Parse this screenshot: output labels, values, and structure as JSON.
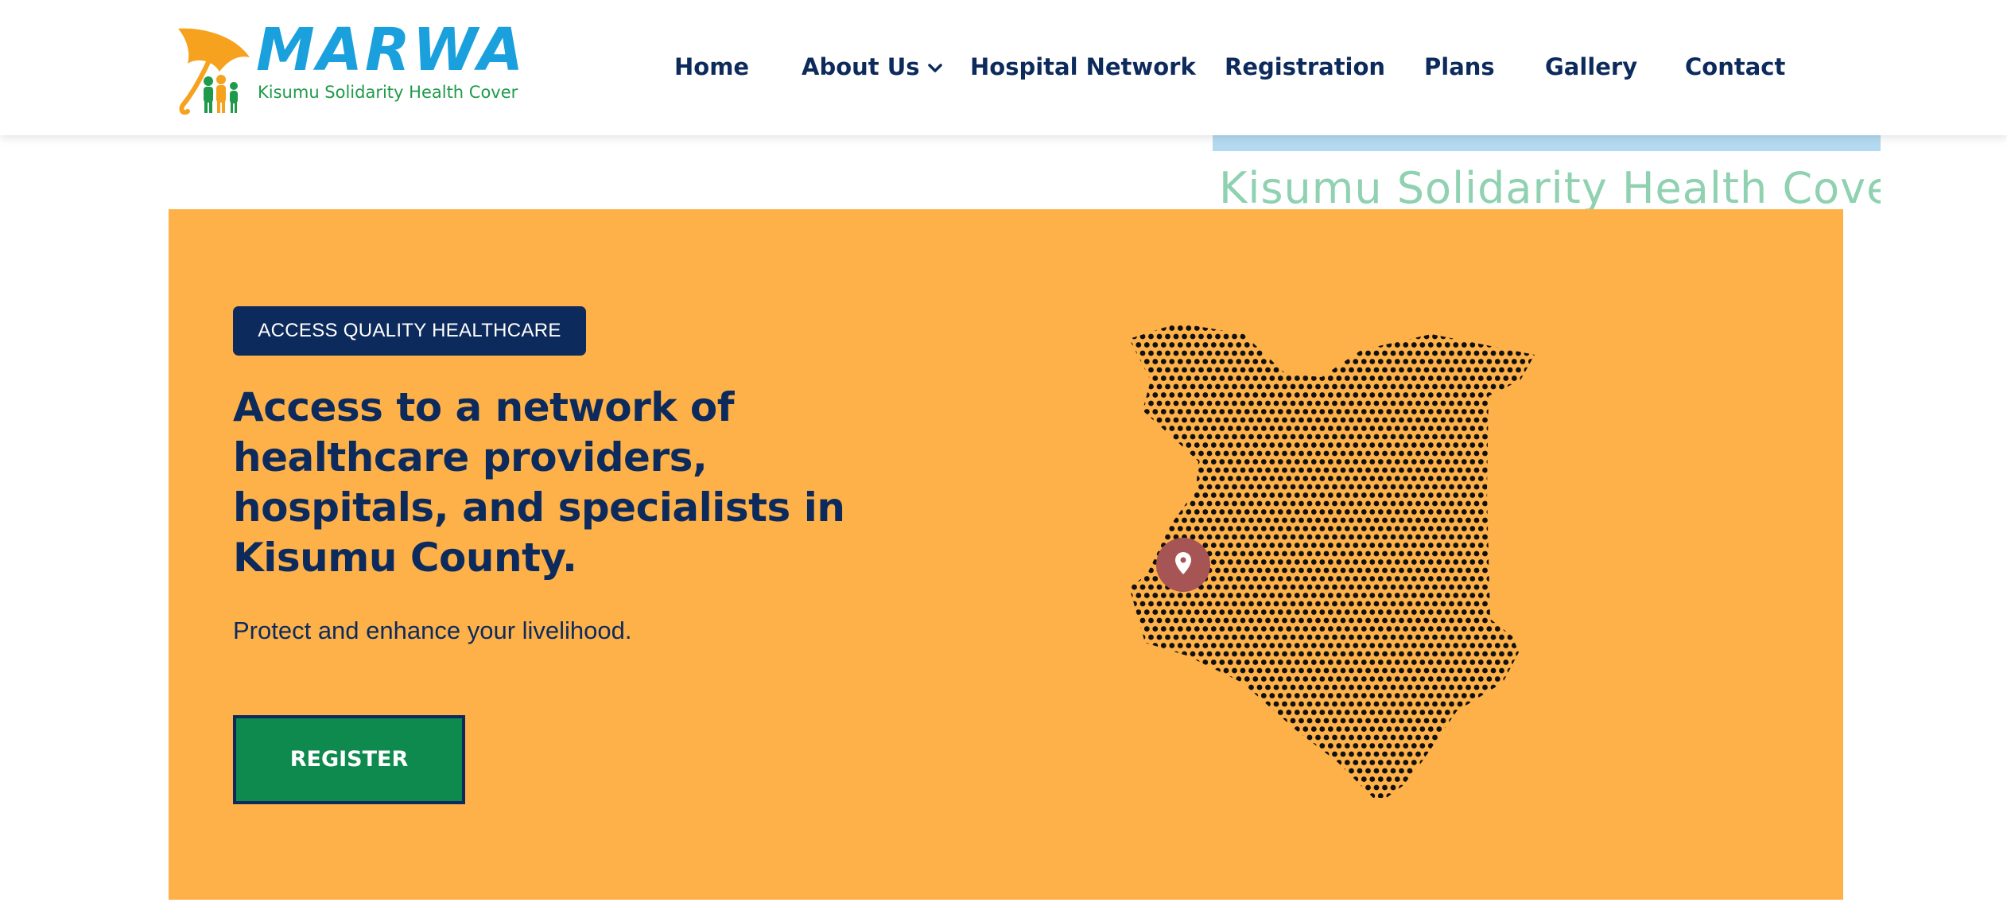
{
  "colors": {
    "navy": "#0d2a5c",
    "hero_bg": "#fdb148",
    "register_green": "#0f8a4f",
    "pin": "#a75454",
    "logo_blue": "#1aa1dd",
    "logo_green": "#1f9a4a",
    "logo_orange": "#f6a21e"
  },
  "logo": {
    "title": "MARWA",
    "tagline": "Kisumu Solidarity Health  Cover",
    "icons": [
      "umbrella-icon",
      "family-icon"
    ]
  },
  "nav": {
    "items": [
      {
        "label": "Home"
      },
      {
        "label": "About Us",
        "icon": "chevron-down-icon"
      },
      {
        "label": "Hospital Network"
      },
      {
        "label": "Registration"
      },
      {
        "label": "Plans"
      },
      {
        "label": "Gallery"
      },
      {
        "label": "Contact"
      }
    ]
  },
  "watermark": {
    "text": "Kisumu Solidarity Health  Cover"
  },
  "hero": {
    "badge": "ACCESS QUALITY HEALTHCARE",
    "headline": "Access to a network of healthcare providers, hospitals, and specialists in Kisumu County.",
    "subtext": "Protect and enhance your livelihood.",
    "register_label": "REGISTER",
    "map_icon": "kenya-map-dotted",
    "pin_icon": "location-pin-icon"
  }
}
